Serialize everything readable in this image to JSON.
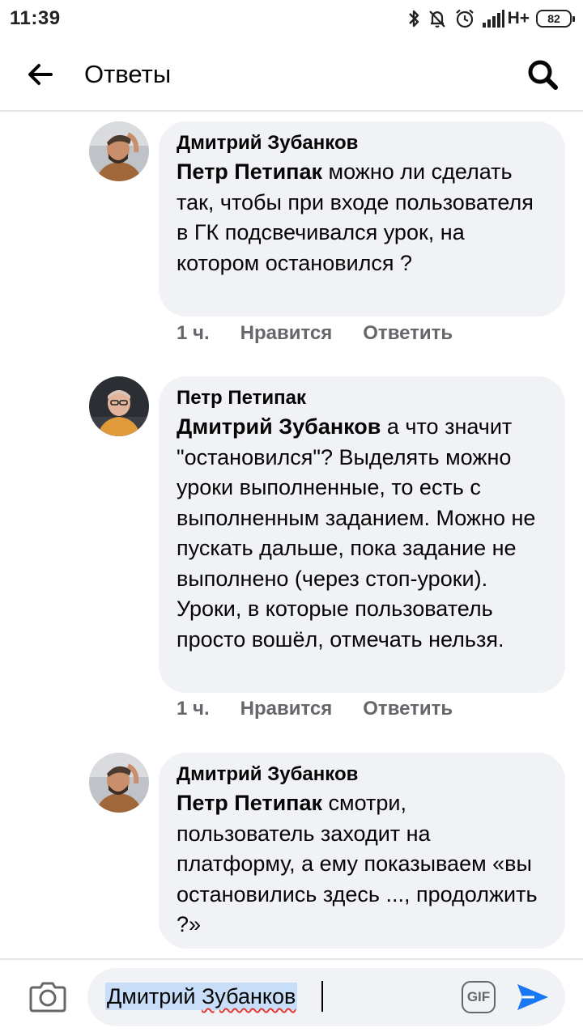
{
  "status_bar": {
    "time": "11:39",
    "network": "H+",
    "battery": "82",
    "icons": [
      "bluetooth-icon",
      "mute-icon",
      "alarm-icon",
      "signal-icon",
      "battery-icon"
    ]
  },
  "header": {
    "title": "Ответы",
    "back_icon": "back-arrow-icon",
    "search_icon": "search-icon"
  },
  "comments": [
    {
      "author": "Дмитрий Зубанков",
      "mention": "Петр Петипак",
      "text": " можно ли сделать так, чтобы при входе пользователя в ГК подсвечивался урок, на котором остановился ?",
      "time": "1 ч.",
      "like": "Нравится",
      "reply": "Ответить"
    },
    {
      "author": "Петр Петипак",
      "mention": "Дмитрий Зубанков",
      "text": " а что значит \"остановился\"? Выделять можно уроки выполненные, то есть с выполненным заданием. Можно не пускать дальше, пока задание не выполнено (через стоп-уроки). Уроки, в которые пользователь просто вошёл, отмечать нельзя.",
      "time": "1 ч.",
      "like": "Нравится",
      "reply": "Ответить"
    },
    {
      "author": "Дмитрий Зубанков",
      "mention": "Петр Петипак",
      "text": " смотри, пользователь заходит на платформу, а ему показываем «вы остановились здесь ..., продолжить ?»"
    }
  ],
  "composer": {
    "value_first": "Дмитрий ",
    "value_last": "Зубанков",
    "camera_icon": "camera-icon",
    "gif_label": "GIF",
    "send_icon": "send-icon"
  },
  "colors": {
    "bubble": "#f0f2f5",
    "secondary_text": "#65676b",
    "send_accent": "#1877f2",
    "selection": "#c8ddf7"
  }
}
